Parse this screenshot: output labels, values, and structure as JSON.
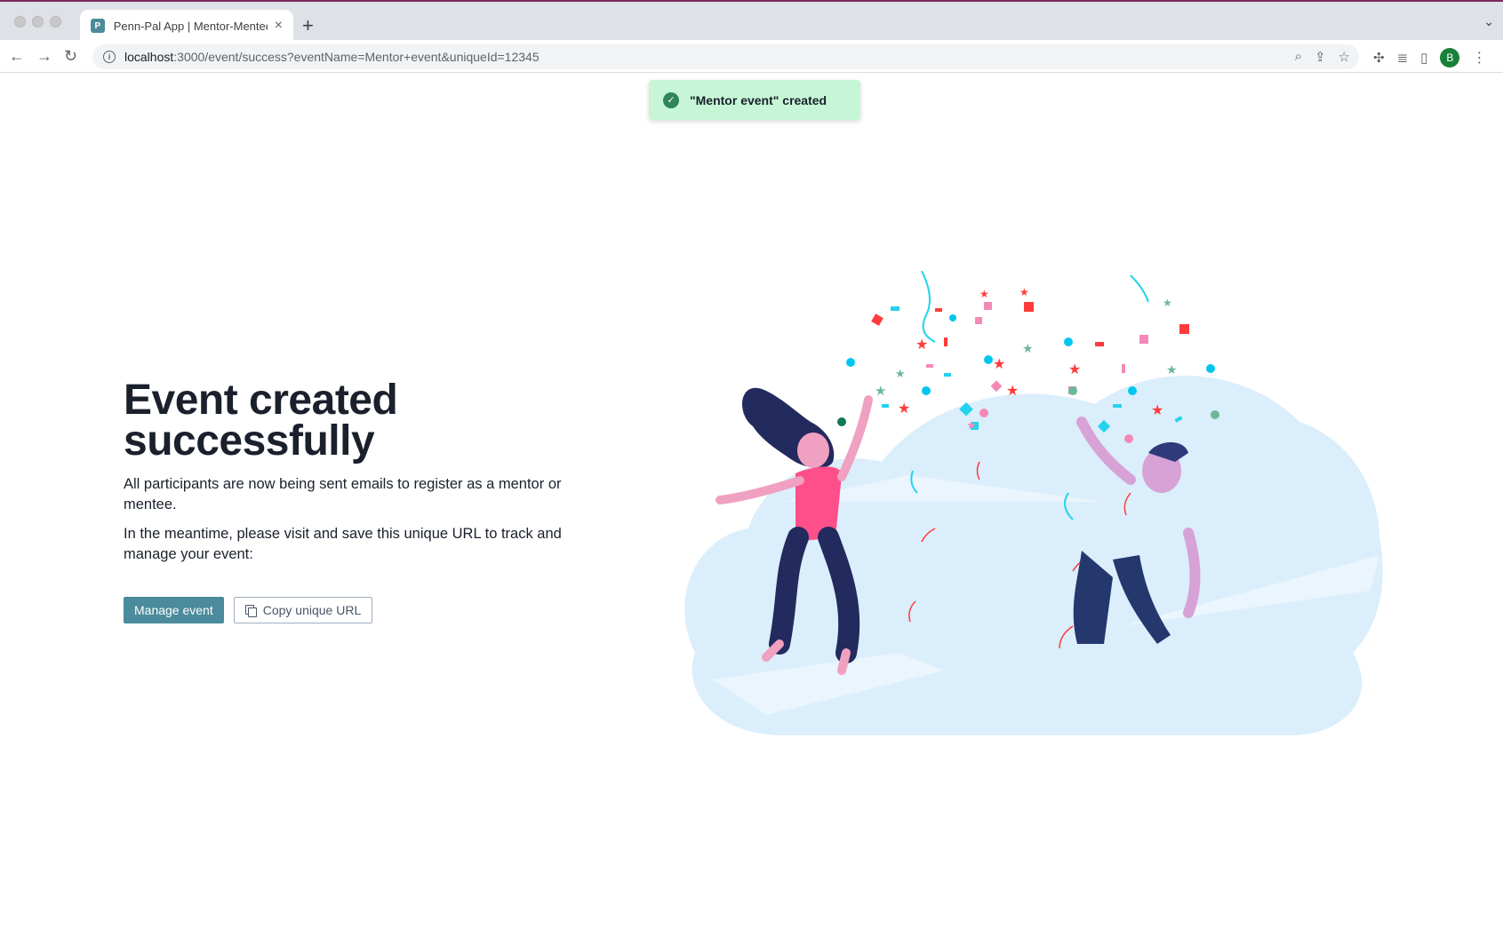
{
  "browser": {
    "tab_title": "Penn-Pal App | Mentor-Mentee",
    "url_host": "localhost",
    "url_path": ":3000/event/success?eventName=Mentor+event&uniqueId=12345",
    "profile_initial": "B"
  },
  "toast": {
    "message": "\"Mentor event\" created"
  },
  "main": {
    "heading_line1": "Event created",
    "heading_line2": "successfully",
    "paragraph1": "All participants are now being sent emails to register as a mentor or mentee.",
    "paragraph2": "In the meantime, please visit and save this unique URL to track and manage your event:",
    "manage_button": "Manage event",
    "copy_button": "Copy unique URL"
  },
  "colors": {
    "primary": "#4b8b9b",
    "toast_bg": "#c6f6d5",
    "heading": "#1a202c",
    "cloud": "#dbeefb",
    "shirt": "#ff4f8b",
    "pants": "#232a5e"
  },
  "icons": [
    "info-icon",
    "zoom-icon",
    "share-icon",
    "star-icon",
    "extension-icon",
    "media-icon",
    "sidepanel-icon",
    "check-circle-icon",
    "copy-icon",
    "celebration-illustration"
  ]
}
